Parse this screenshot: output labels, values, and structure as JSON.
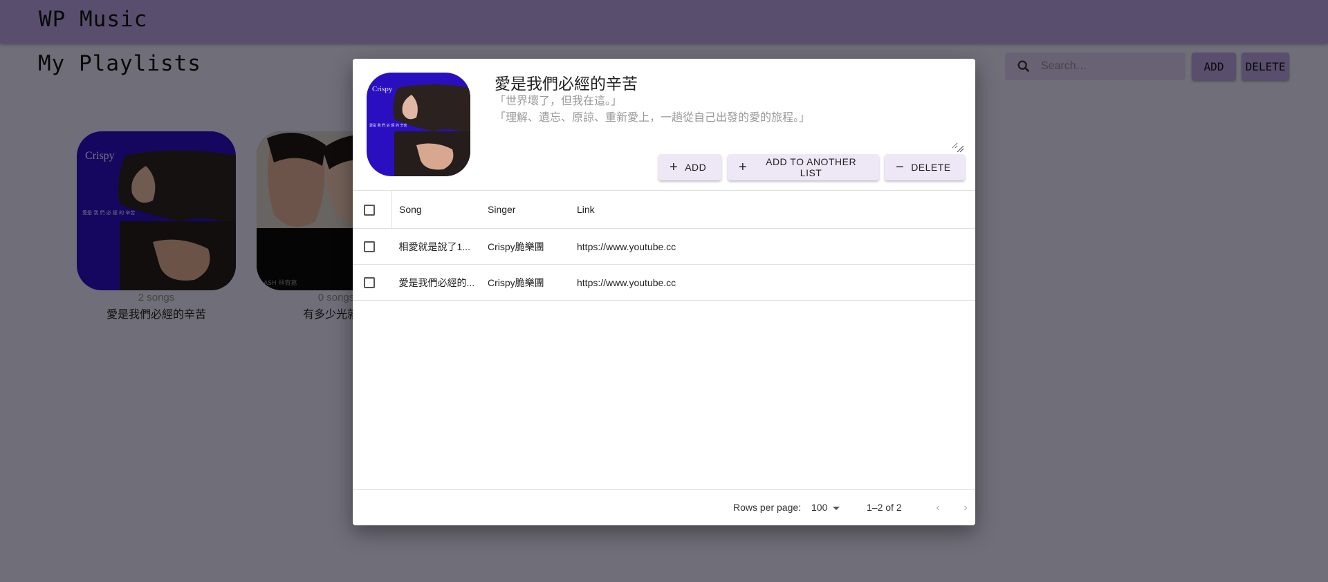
{
  "app": {
    "title": "WP Music",
    "page_title": "My Playlists"
  },
  "toolbar": {
    "search_placeholder": "Search…",
    "add_label": "ADD",
    "delete_label": "DELETE"
  },
  "playlists": [
    {
      "count": "2 songs",
      "name": "愛是我們必經的辛苦"
    },
    {
      "count": "0 songs",
      "name": "有多少光就有"
    }
  ],
  "dialog": {
    "title": "愛是我們必經的辛苦",
    "description_lines": [
      "「世界壞了，但我在這。」",
      "「理解、遺忘、原諒、重新愛上，一趟從自己出發的愛的旅程。」"
    ],
    "buttons": {
      "add": "ADD",
      "add_to_another": "ADD TO ANOTHER LIST",
      "delete": "DELETE"
    },
    "table": {
      "headers": {
        "song": "Song",
        "singer": "Singer",
        "link": "Link"
      },
      "rows": [
        {
          "song": "相愛就是說了1...",
          "singer": "Crispy脆樂團",
          "link": "https://www.youtube.cc"
        },
        {
          "song": "愛是我們必經的...",
          "singer": "Crispy脆樂團",
          "link": "https://www.youtube.cc"
        }
      ]
    },
    "pagination": {
      "rows_label": "Rows per page:",
      "rows_value": "100",
      "range": "1–2 of 2"
    }
  },
  "colors": {
    "appbar": "#b39ddb",
    "cover_blue": "#2a0fc0",
    "dialog_button": "#ede7f6"
  },
  "icons": {
    "search": "search-icon",
    "plus": "plus-icon",
    "minus": "minus-icon",
    "prev": "chevron-left-icon",
    "next": "chevron-right-icon"
  }
}
